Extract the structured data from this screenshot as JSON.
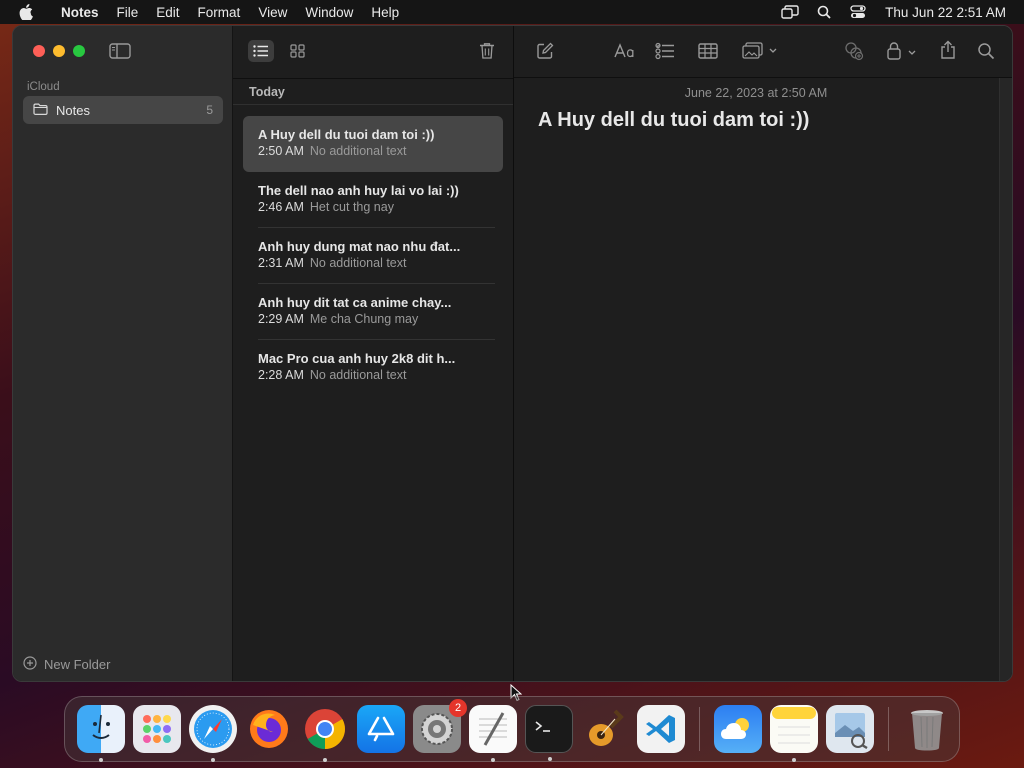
{
  "menubar": {
    "app_name": "Notes",
    "items": [
      "File",
      "Edit",
      "Format",
      "View",
      "Window",
      "Help"
    ],
    "clock": "Thu Jun 22  2:51 AM"
  },
  "sidebar": {
    "section": "iCloud",
    "folder": {
      "label": "Notes",
      "count": "5"
    },
    "new_folder_label": "New Folder"
  },
  "list": {
    "header": "Today",
    "notes": [
      {
        "title": "A Huy dell du tuoi dam toi :))",
        "time": "2:50 AM",
        "preview": "No additional text"
      },
      {
        "title": "The dell nao anh huy lai vo lai :))",
        "time": "2:46 AM",
        "preview": "Het cut thg nay"
      },
      {
        "title": "Anh huy dung mat nao nhu đat...",
        "time": "2:31 AM",
        "preview": "No additional text"
      },
      {
        "title": "Anh huy dit tat ca anime chay...",
        "time": "2:29 AM",
        "preview": "Me cha Chung may"
      },
      {
        "title": "Mac Pro cua anh huy 2k8 dit h...",
        "time": "2:28 AM",
        "preview": "No additional text"
      }
    ]
  },
  "editor": {
    "date": "June 22, 2023 at 2:50 AM",
    "title": "A Huy dell du tuoi dam toi :))"
  },
  "dock": {
    "apps": [
      "finder",
      "launchpad",
      "safari",
      "firefox",
      "chrome",
      "app-store",
      "system-settings",
      "textedit",
      "terminal",
      "garageband",
      "vscode",
      "weather",
      "notes",
      "preview",
      "trash"
    ],
    "settings_badge": "2"
  },
  "colors": {
    "accent": "#fe5f57",
    "window_bg": "#1e1e1e",
    "sidebar_bg": "#2b2b2b"
  }
}
